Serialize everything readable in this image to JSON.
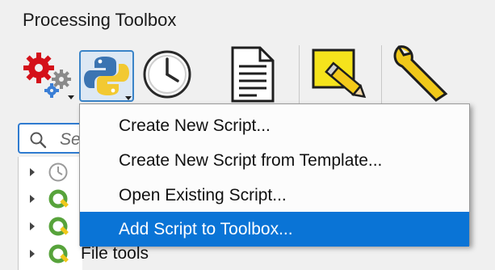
{
  "panel": {
    "title": "Processing Toolbox"
  },
  "toolbar": {
    "buttons": [
      {
        "icon": "models-gears-icon"
      },
      {
        "icon": "python-scripts-icon"
      },
      {
        "icon": "history-clock-icon"
      },
      {
        "icon": "results-document-icon"
      },
      {
        "icon": "edit-features-pencil-icon"
      },
      {
        "icon": "options-wrench-icon"
      }
    ]
  },
  "search": {
    "placeholder": "Se"
  },
  "tree": {
    "items": [
      {
        "icon": "recent-clock-icon",
        "label": ""
      },
      {
        "icon": "qgis-q-icon",
        "label": ""
      },
      {
        "icon": "qgis-q-icon",
        "label": ""
      },
      {
        "icon": "qgis-q-icon",
        "label": "File tools"
      }
    ]
  },
  "menu": {
    "items": [
      {
        "label": "Create New Script...",
        "selected": false
      },
      {
        "label": "Create New Script from Template...",
        "selected": false
      },
      {
        "label": "Open Existing Script...",
        "selected": false
      },
      {
        "label": "Add Script to Toolbox...",
        "selected": true
      }
    ]
  },
  "colors": {
    "selection": "#0a74d6",
    "focus_border": "#2f7bd0",
    "qgis_green": "#57a33b",
    "python_blue": "#3b74b2",
    "python_yellow": "#f2c932",
    "gear_red": "#d4111a"
  }
}
